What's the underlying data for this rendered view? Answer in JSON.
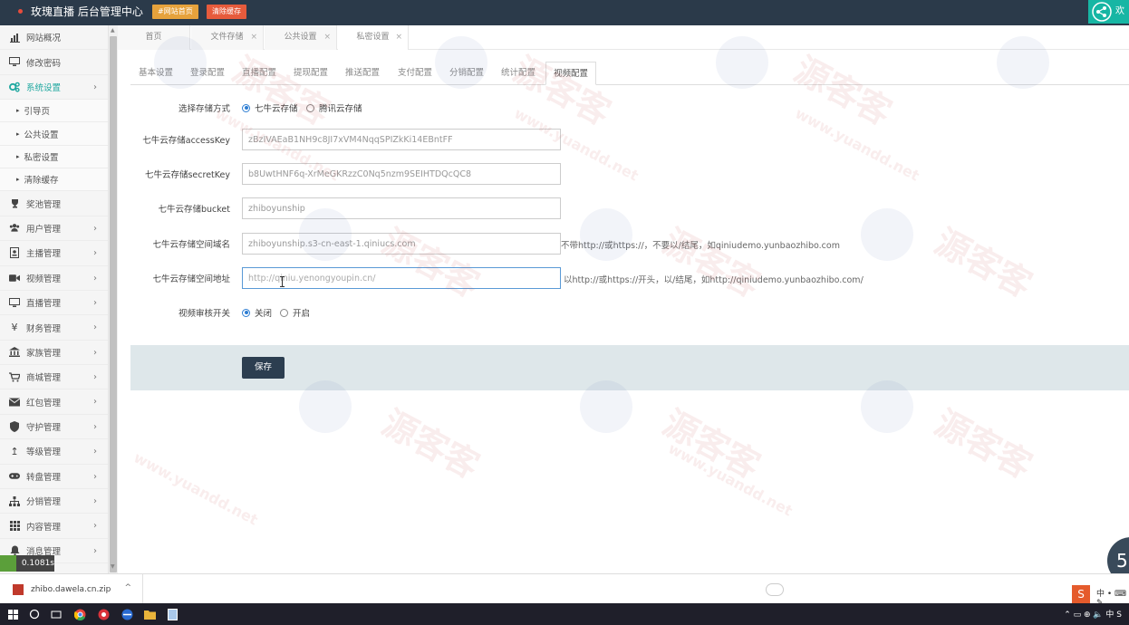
{
  "header": {
    "title": "玫瑰直播 后台管理中心",
    "home_button": "#网站首页",
    "clear_cache_button": "清除缓存",
    "welcome_text": "欢"
  },
  "sidebar": {
    "items": [
      {
        "label": "网站概况",
        "icon": "chart-icon"
      },
      {
        "label": "修改密码",
        "icon": "monitor-icon"
      },
      {
        "label": "系统设置",
        "icon": "gears-icon",
        "active": true,
        "children": [
          "引导页",
          "公共设置",
          "私密设置",
          "清除缓存"
        ]
      },
      {
        "label": "奖池管理",
        "icon": "trophy-icon"
      },
      {
        "label": "用户管理",
        "icon": "users-icon"
      },
      {
        "label": "主播管理",
        "icon": "id-card-icon"
      },
      {
        "label": "视频管理",
        "icon": "video-icon"
      },
      {
        "label": "直播管理",
        "icon": "desktop-icon"
      },
      {
        "label": "财务管理",
        "icon": "yen-icon"
      },
      {
        "label": "家族管理",
        "icon": "bank-icon"
      },
      {
        "label": "商城管理",
        "icon": "cart-icon"
      },
      {
        "label": "红包管理",
        "icon": "envelope-icon"
      },
      {
        "label": "守护管理",
        "icon": "shield-icon"
      },
      {
        "label": "等级管理",
        "icon": "level-icon"
      },
      {
        "label": "转盘管理",
        "icon": "gamepad-icon"
      },
      {
        "label": "分销管理",
        "icon": "sitemap-icon"
      },
      {
        "label": "内容管理",
        "icon": "grid-icon"
      },
      {
        "label": "消息管理",
        "icon": "bell-icon"
      }
    ]
  },
  "page_tabs": [
    {
      "label": "首页"
    },
    {
      "label": "文件存储",
      "close": "×"
    },
    {
      "label": "公共设置",
      "close": "×"
    },
    {
      "label": "私密设置",
      "close": "×",
      "active": true
    }
  ],
  "sub_tabs": [
    "基本设置",
    "登录配置",
    "直播配置",
    "提现配置",
    "推送配置",
    "支付配置",
    "分销配置",
    "统计配置",
    "视频配置"
  ],
  "form": {
    "storage_label": "选择存储方式",
    "storage_options": [
      "七牛云存储",
      "腾讯云存储"
    ],
    "access_key_label": "七牛云存储accessKey",
    "access_key_value": "zBzIVAEaB1NH9c8JI7xVM4NqqSPIZkKi14EBntFF",
    "secret_key_label": "七牛云存储secretKey",
    "secret_key_value": "b8UwtHNF6q-XrMeGKRzzC0Nq5nzm9SEIHTDQcQC8",
    "bucket_label": "七牛云存储bucket",
    "bucket_value": "zhiboyunship",
    "domain_label": "七牛云存储空间域名",
    "domain_value": "zhiboyunship.s3-cn-east-1.qiniucs.com",
    "domain_hint": "不带http://或https://，不要以/结尾，如qiniudemo.yunbaozhibo.com",
    "url_label": "七牛云存储空间地址",
    "url_value": "http://qiniu.yenongyoupin.cn/",
    "url_hint": "以http://或https://开头，以/结尾，如http://qiniudemo.yunbaozhibo.com/",
    "review_label": "视频审核开关",
    "review_options": [
      "关闭",
      "开启"
    ],
    "save_label": "保存"
  },
  "status": {
    "load_time": "0.1081s"
  },
  "downloads": {
    "file_name": "zhibo.dawela.cn.zip",
    "chevron": "^"
  },
  "right_widget_text": "5",
  "ime": {
    "logo": "S",
    "toolbar": "中 • ⌨ ✎"
  },
  "taskbar": {
    "tray": "⌃  ▭  ⊕  🔈  中  S"
  },
  "watermark": {
    "cn": "源客客",
    "url": "www.yuandd.net"
  },
  "colors": {
    "topbar": "#2b3a4a",
    "accent": "#20a8a0",
    "save_button": "#2c3e50",
    "action_bar": "#dee7ea"
  }
}
